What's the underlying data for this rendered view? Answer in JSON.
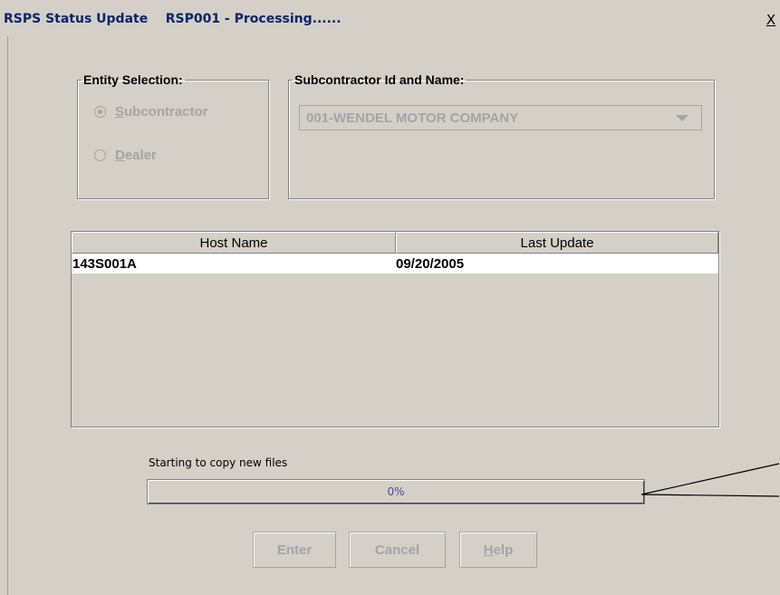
{
  "window": {
    "title": "RSPS Status Update    RSP001 - Processing......",
    "close_label": "X"
  },
  "entity_selection": {
    "legend": "Entity Selection:",
    "options": [
      {
        "label": "Subcontractor",
        "mnemonic": "S",
        "rest": "ubcontractor",
        "checked": true
      },
      {
        "label": "Dealer",
        "mnemonic": "D",
        "rest": "ealer",
        "checked": false
      }
    ]
  },
  "subcontractor": {
    "legend": "Subcontractor Id and Name:",
    "selected": "001-WENDEL MOTOR COMPANY"
  },
  "table": {
    "columns": [
      "Host Name",
      "Last Update"
    ],
    "rows": [
      {
        "host": "143S001A",
        "last_update": "09/20/2005"
      }
    ]
  },
  "status": {
    "message": "Starting to copy new files",
    "progress_label": "0%",
    "progress_fraction": 0
  },
  "buttons": {
    "enter": "Enter",
    "cancel": "Cancel",
    "help_mnemonic": "H",
    "help_rest": "elp"
  },
  "colors": {
    "background": "#d4d0c8",
    "title_text": "#0a246a",
    "disabled_text": "#a4a4a4"
  }
}
